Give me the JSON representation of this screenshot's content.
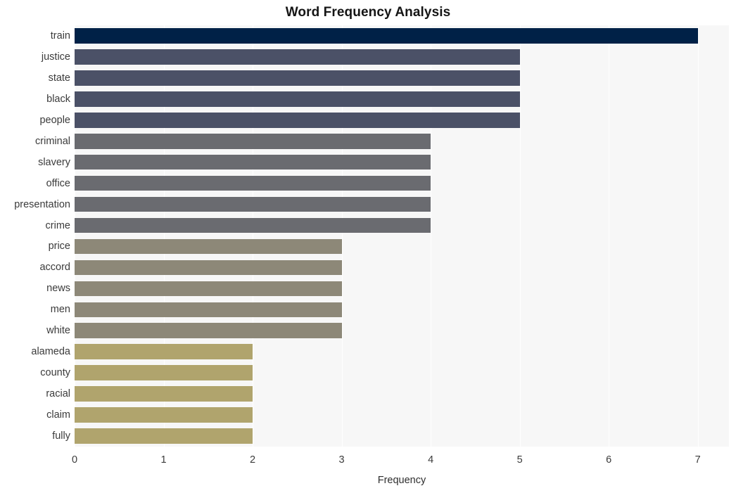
{
  "chart_data": {
    "type": "bar",
    "orientation": "horizontal",
    "title": "Word Frequency Analysis",
    "xlabel": "Frequency",
    "ylabel": "",
    "xlim": [
      0,
      7.35
    ],
    "xticks": [
      0,
      1,
      2,
      3,
      4,
      5,
      6,
      7
    ],
    "xtick_labels": [
      "0",
      "1",
      "2",
      "3",
      "4",
      "5",
      "6",
      "7"
    ],
    "grid": true,
    "grid_axis": "x",
    "grid_color": "#ffffff",
    "plot_background": "#f7f7f7",
    "figure_background": "#ffffff",
    "legend": null,
    "categories": [
      "train",
      "justice",
      "state",
      "black",
      "people",
      "criminal",
      "slavery",
      "office",
      "presentation",
      "crime",
      "price",
      "accord",
      "news",
      "men",
      "white",
      "alameda",
      "county",
      "racial",
      "claim",
      "fully"
    ],
    "values": [
      7,
      5,
      5,
      5,
      5,
      4,
      4,
      4,
      4,
      4,
      3,
      3,
      3,
      3,
      3,
      2,
      2,
      2,
      2,
      2
    ],
    "bar_colors": [
      "#002147",
      "#4b5167",
      "#4b5167",
      "#4b5167",
      "#4b5167",
      "#6a6b70",
      "#6a6b70",
      "#6a6b70",
      "#6a6b70",
      "#6a6b70",
      "#8d8878",
      "#8d8878",
      "#8d8878",
      "#8d8878",
      "#8d8878",
      "#b0a46d",
      "#b0a46d",
      "#b0a46d",
      "#b0a46d",
      "#b0a46d"
    ],
    "palette": {
      "tier_1_navy": "#002147",
      "tier_2_slate": "#4b5167",
      "tier_3_gray": "#6a6b70",
      "tier_4_taupe": "#8d8878",
      "tier_5_khaki": "#b0a46d"
    }
  }
}
